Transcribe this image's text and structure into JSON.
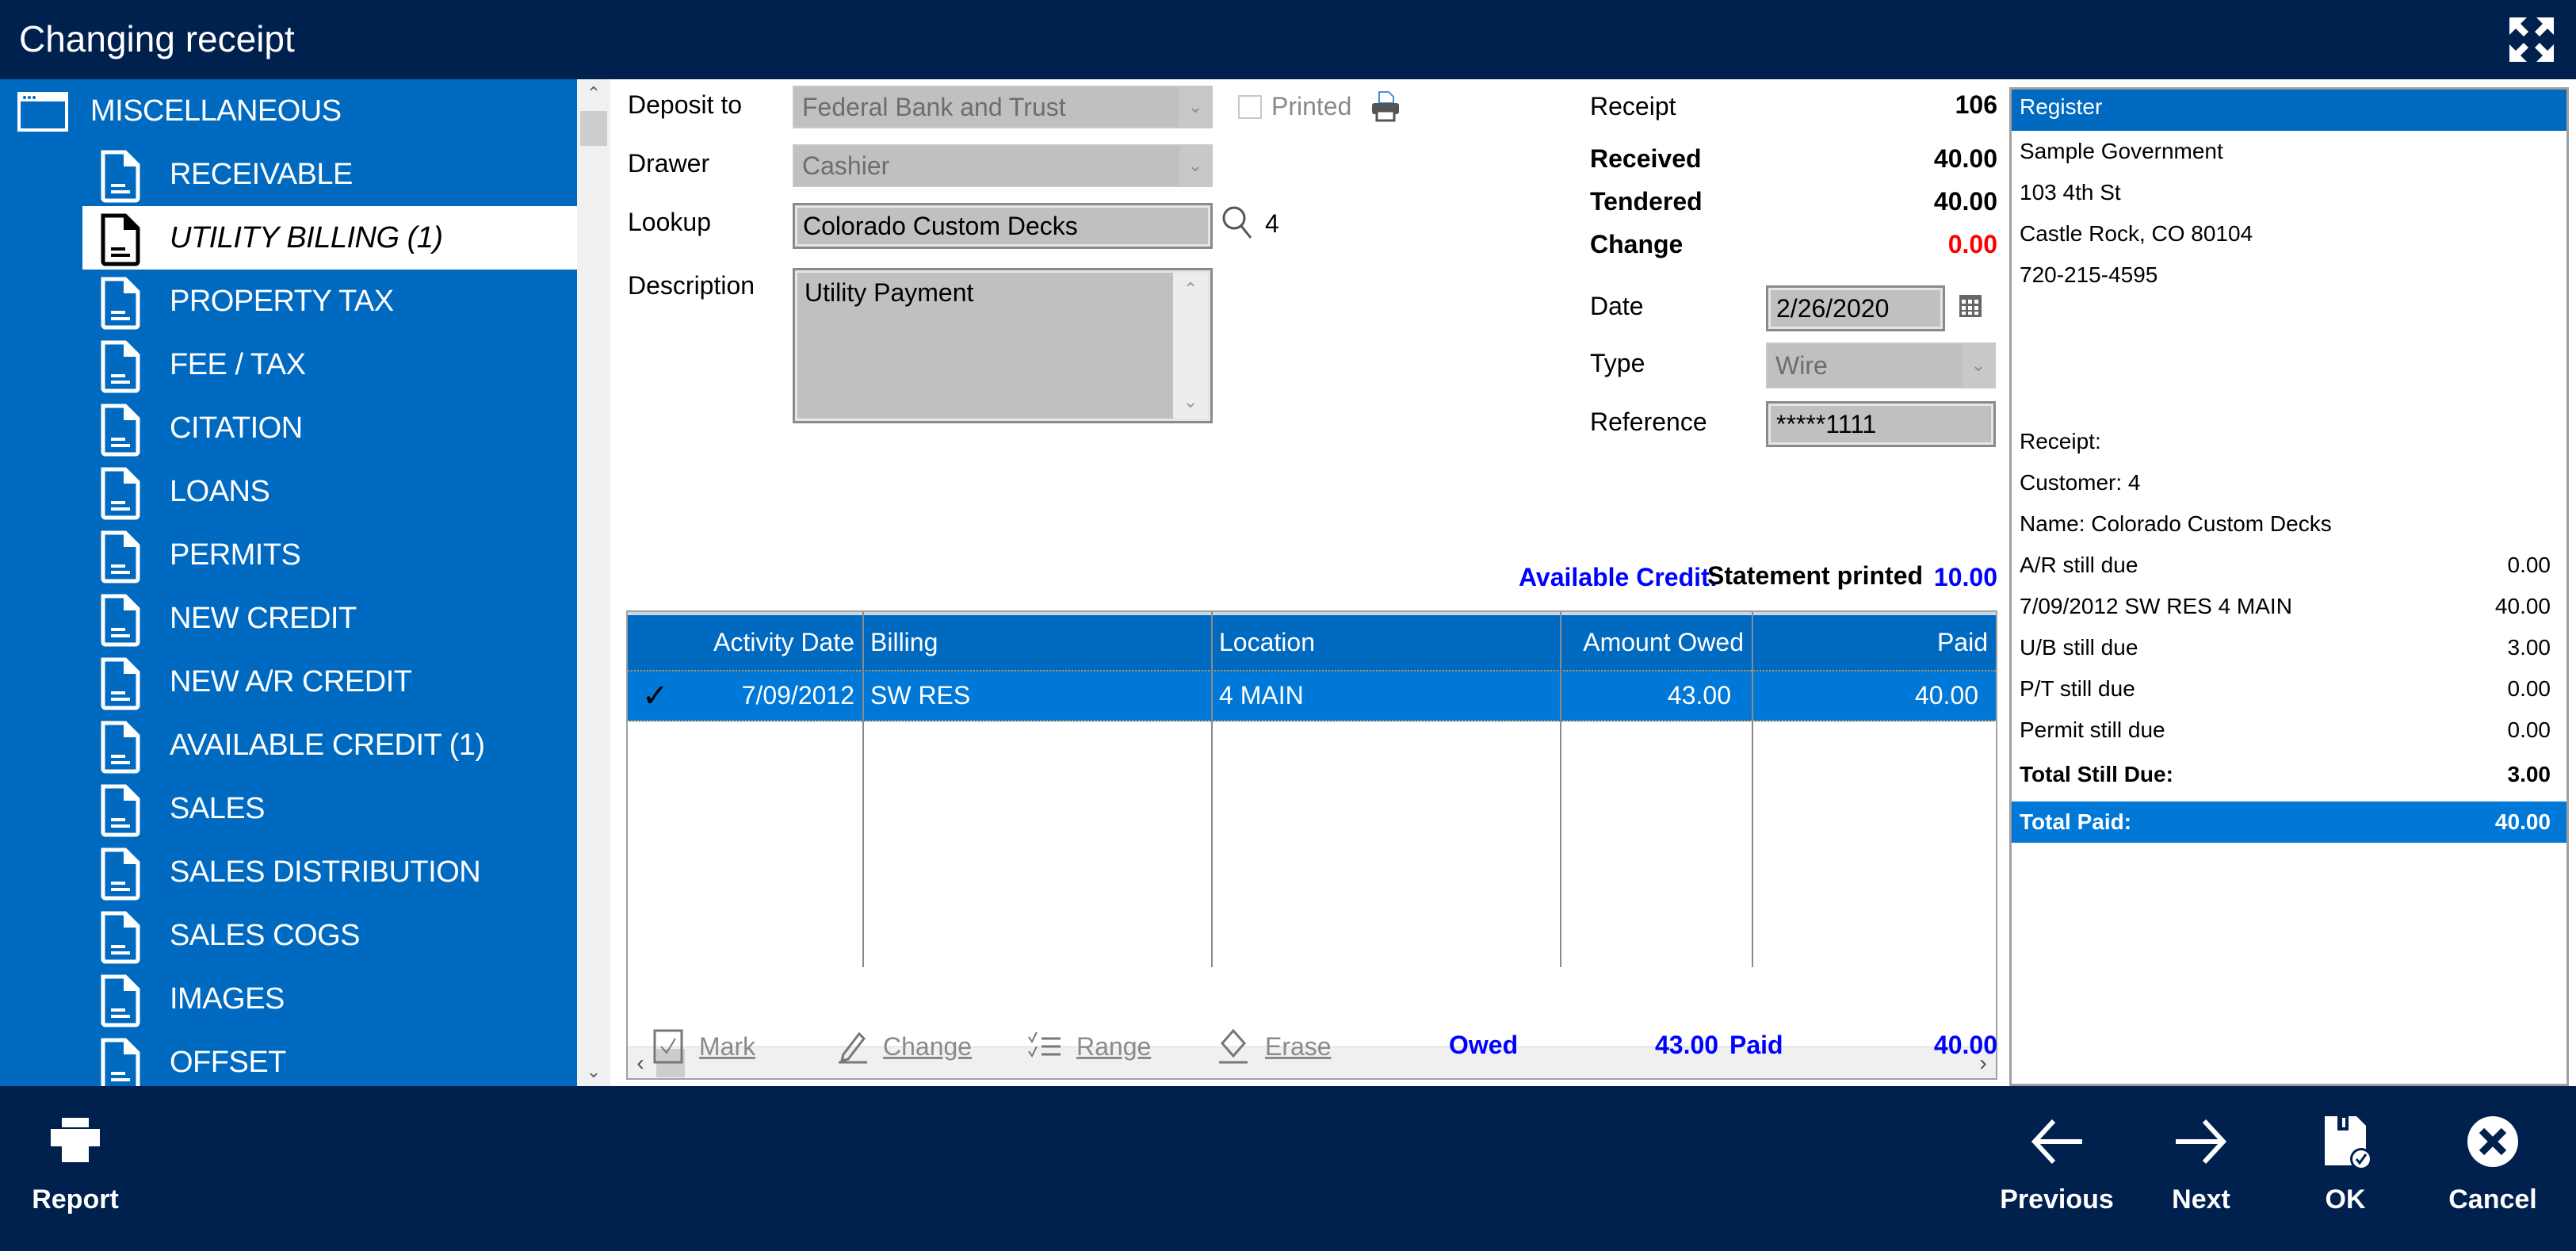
{
  "window": {
    "title": "Changing receipt",
    "maximize_icon": "expand-arrows-icon"
  },
  "sidebar": {
    "root": {
      "label": "MISCELLANEOUS",
      "icon": "window-icon"
    },
    "items": [
      {
        "label": "RECEIVABLE",
        "icon": "document-icon",
        "selected": false
      },
      {
        "label": "UTILITY BILLING (1)",
        "icon": "document-icon",
        "selected": true
      },
      {
        "label": "PROPERTY TAX",
        "icon": "document-icon",
        "selected": false
      },
      {
        "label": "FEE / TAX",
        "icon": "document-icon",
        "selected": false
      },
      {
        "label": "CITATION",
        "icon": "document-icon",
        "selected": false
      },
      {
        "label": "LOANS",
        "icon": "document-icon",
        "selected": false
      },
      {
        "label": "PERMITS",
        "icon": "document-icon",
        "selected": false
      },
      {
        "label": "NEW CREDIT",
        "icon": "document-icon",
        "selected": false
      },
      {
        "label": "NEW A/R CREDIT",
        "icon": "document-icon",
        "selected": false
      },
      {
        "label": "AVAILABLE CREDIT (1)",
        "icon": "document-icon",
        "selected": false
      },
      {
        "label": "SALES",
        "icon": "document-icon",
        "selected": false
      },
      {
        "label": "SALES DISTRIBUTION",
        "icon": "document-icon",
        "selected": false
      },
      {
        "label": "SALES COGS",
        "icon": "document-icon",
        "selected": false
      },
      {
        "label": "IMAGES",
        "icon": "document-icon",
        "selected": false
      },
      {
        "label": "OFFSET",
        "icon": "document-icon",
        "selected": false
      }
    ]
  },
  "form": {
    "deposit_to": {
      "label": "Deposit to",
      "value": "Federal Bank and Trust"
    },
    "printed": {
      "label": "Printed",
      "checked": false
    },
    "drawer": {
      "label": "Drawer",
      "value": "Cashier"
    },
    "lookup": {
      "label": "Lookup",
      "value": "Colorado Custom Decks",
      "id": "4"
    },
    "description": {
      "label": "Description",
      "value": "Utility Payment"
    },
    "receipt": {
      "label": "Receipt",
      "value": "106"
    },
    "received": {
      "label": "Received",
      "value": "40.00"
    },
    "tendered": {
      "label": "Tendered",
      "value": "40.00"
    },
    "change": {
      "label": "Change",
      "value": "0.00"
    },
    "date": {
      "label": "Date",
      "value": "2/26/2020"
    },
    "type": {
      "label": "Type",
      "value": "Wire"
    },
    "reference": {
      "label": "Reference",
      "value": "*****1111"
    },
    "available_credit": {
      "label": "Available Credit:",
      "value": "10.00"
    },
    "statement_printed": "Statement printed"
  },
  "grid": {
    "columns": [
      "Activity Date",
      "Billing",
      "Location",
      "Amount Owed",
      "Paid"
    ],
    "rows": [
      {
        "checked": true,
        "activity_date": "7/09/2012",
        "billing": "SW RES",
        "location": "4 MAIN",
        "amount_owed": "43.00",
        "paid": "40.00"
      }
    ]
  },
  "grid_toolbar": {
    "mark": "Mark",
    "change": "Change",
    "range": "Range",
    "erase": "Erase",
    "owed_label": "Owed",
    "owed_value": "43.00",
    "paid_label": "Paid",
    "paid_value": "40.00"
  },
  "register": {
    "header": "Register",
    "org_lines": [
      "Sample Government",
      "103 4th St",
      "Castle Rock, CO 80104",
      "720-215-4595"
    ],
    "receipt_label": "Receipt:",
    "customer": "Customer: 4",
    "name": "Name: Colorado Custom Decks",
    "lines": [
      {
        "label": "A/R still due",
        "value": "0.00"
      },
      {
        "label": "7/09/2012 SW RES 4 MAIN",
        "value": "40.00"
      },
      {
        "label": "U/B still due",
        "value": "3.00"
      },
      {
        "label": "P/T still due",
        "value": "0.00"
      },
      {
        "label": "Permit still due",
        "value": "0.00"
      }
    ],
    "total_still_due": {
      "label": "Total Still Due:",
      "value": "3.00"
    },
    "total_paid": {
      "label": "Total Paid:",
      "value": "40.00"
    }
  },
  "bottom": {
    "report": "Report",
    "previous": "Previous",
    "next": "Next",
    "ok": "OK",
    "cancel": "Cancel"
  },
  "colors": {
    "titlebar": "#00204e",
    "sidebar": "#006ac1",
    "selection": "#0078d7",
    "change_red": "#ff0000",
    "totals_blue": "#0000ff"
  }
}
